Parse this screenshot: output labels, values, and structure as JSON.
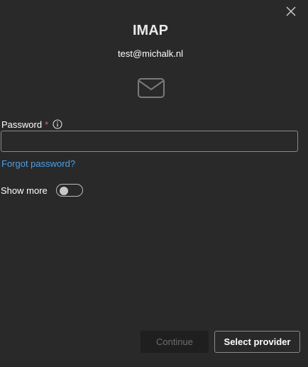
{
  "dialog": {
    "title": "IMAP",
    "email": "test@michalk.nl"
  },
  "icons": {
    "close": "close-icon",
    "mail": "mail-icon",
    "info": "info-icon"
  },
  "form": {
    "password_label": "Password",
    "required_marker": "*",
    "password_value": "",
    "forgot_link": "Forgot password?",
    "show_more_label": "Show more",
    "show_more_on": false
  },
  "actions": {
    "continue_label": "Continue",
    "continue_disabled": true,
    "select_provider_label": "Select provider"
  },
  "colors": {
    "background": "#292929",
    "link": "#4aa0e6",
    "required": "#d16a6a"
  }
}
